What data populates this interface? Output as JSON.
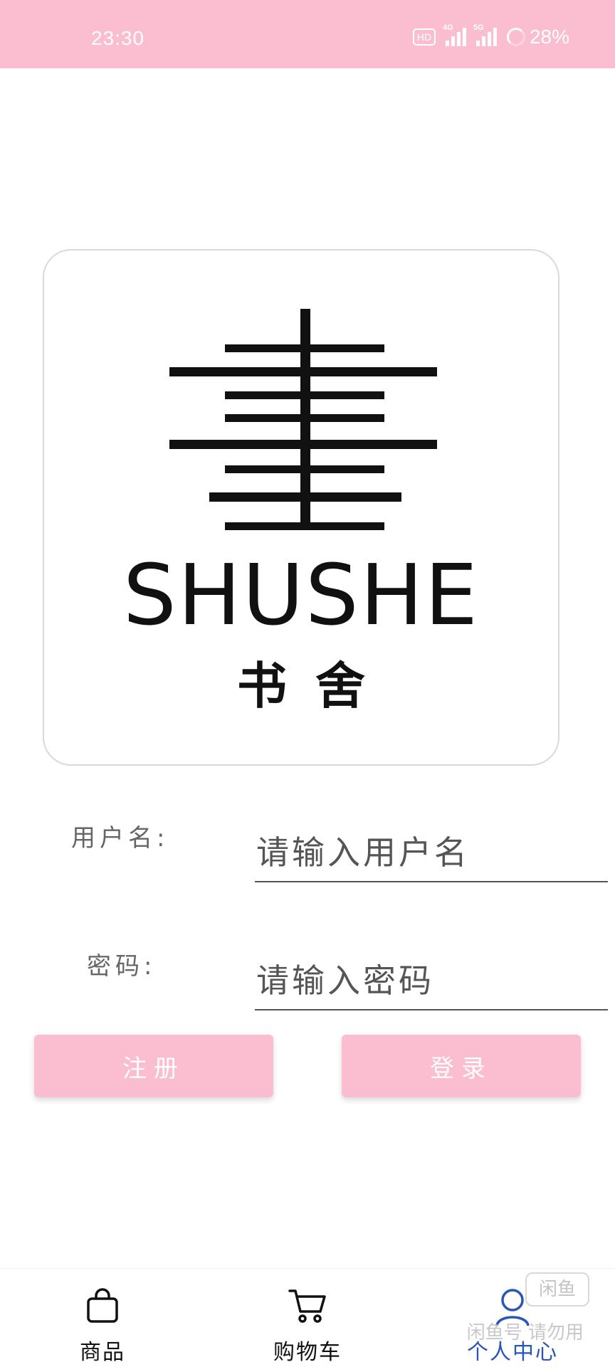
{
  "status_bar": {
    "time": "23:30",
    "hd": "HD",
    "signal_1_tag": "4G",
    "signal_2_tag": "5G",
    "battery": "28%"
  },
  "logo": {
    "text_en": "SHUSHE",
    "text_cn": "书舍"
  },
  "form": {
    "username_label": "用户名:",
    "username_placeholder": "请输入用户名",
    "username_value": "",
    "password_label": "密码:",
    "password_placeholder": "请输入密码",
    "password_value": ""
  },
  "buttons": {
    "register": "注册",
    "login": "登录"
  },
  "bottom_nav": {
    "items": [
      {
        "label": "商品",
        "icon": "shopping-bag-icon"
      },
      {
        "label": "购物车",
        "icon": "cart-icon"
      },
      {
        "label": "个人中心",
        "icon": "user-icon",
        "active": true
      }
    ]
  },
  "watermark": {
    "badge": "闲鱼",
    "text": "闲鱼号  请勿用"
  },
  "colors": {
    "accent": "#fbbdd0",
    "active_nav": "#2b56b9"
  }
}
